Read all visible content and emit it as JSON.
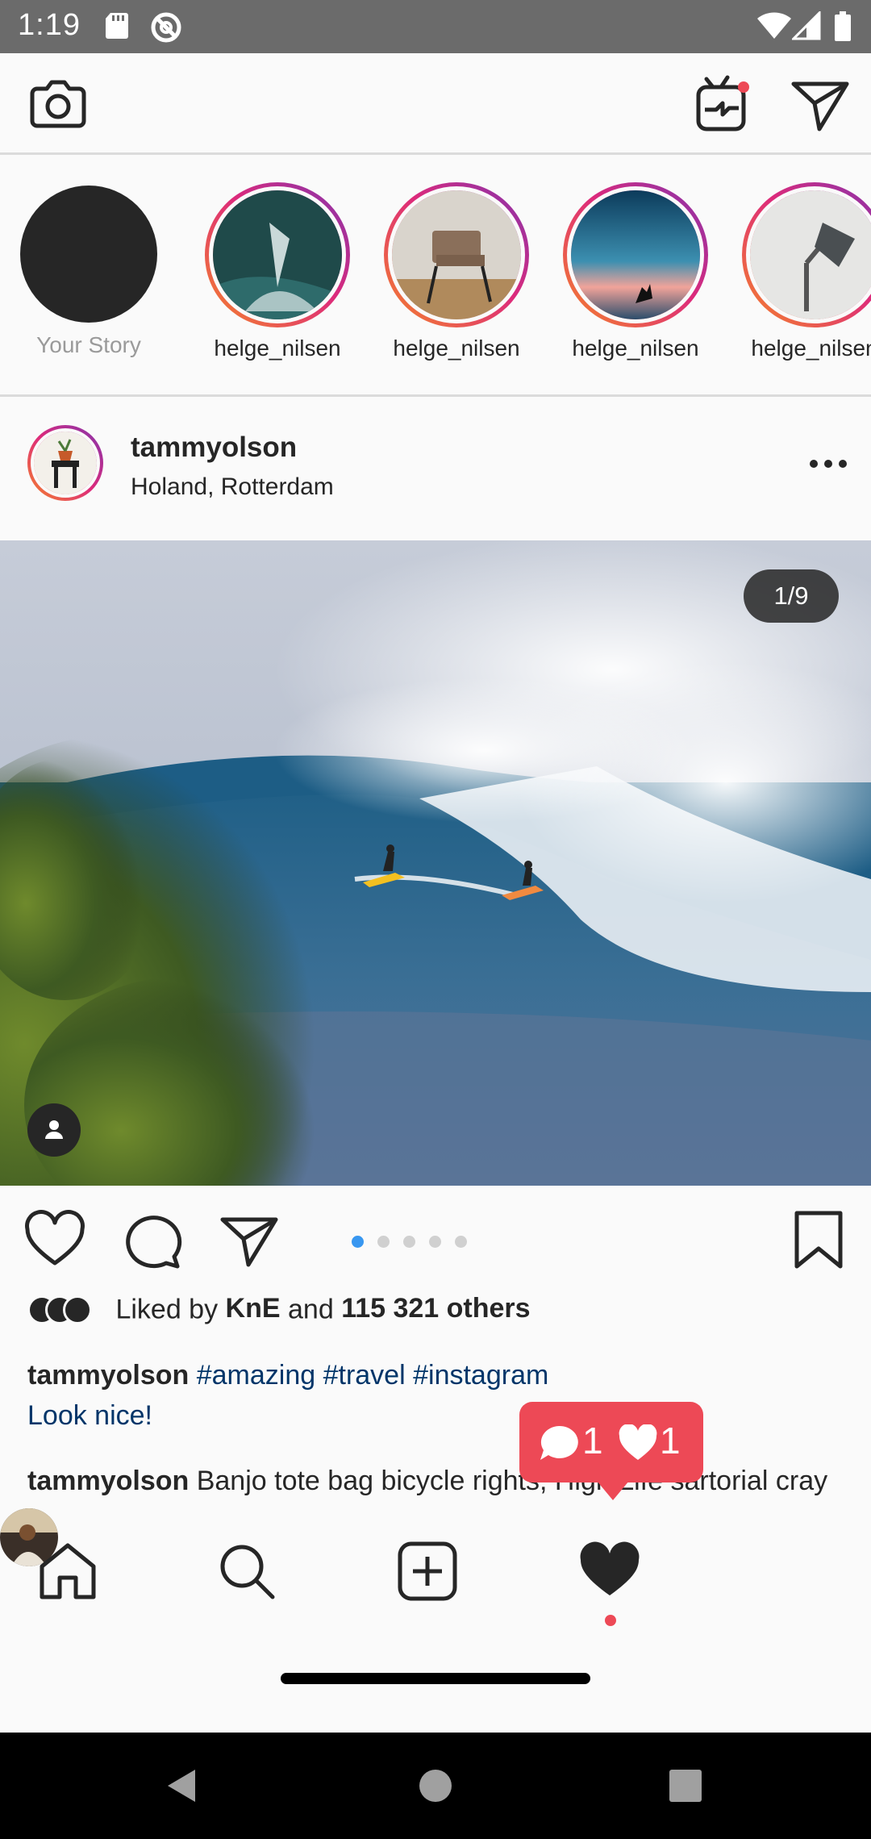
{
  "status_bar": {
    "time": "1:19",
    "icons": [
      "sd-card-icon",
      "no-sync-icon",
      "wifi-icon",
      "cellular-icon",
      "battery-icon"
    ]
  },
  "header": {
    "icons": [
      "camera-icon",
      "igtv-icon",
      "direct-message-icon"
    ],
    "igtv_notification": true
  },
  "stories": [
    {
      "label": "Your Story",
      "own": true
    },
    {
      "label": "helge_nilsen",
      "image": "ocean-surf"
    },
    {
      "label": "helge_nilsen",
      "image": "chair"
    },
    {
      "label": "helge_nilsen",
      "image": "sunset-sea"
    },
    {
      "label": "helge_nilsen",
      "image": "lamp"
    }
  ],
  "post": {
    "username": "tammyolson",
    "location": "Holand, Rotterdam",
    "image_counter": "1/9",
    "carousel": {
      "count": 5,
      "active": 0
    },
    "likes": {
      "prefix": "Liked by",
      "first_user": "KnE",
      "middle": "and",
      "others": "115 321 others"
    },
    "caption": {
      "username": "tammyolson",
      "tags": [
        "#amazing",
        "#travel",
        "#instagram"
      ],
      "line2": "Look nice!"
    },
    "comment": {
      "username": "tammyolson",
      "text": "Banjo tote bag bicycle rights, High Life sartorial cray craft beer whatever street art"
    }
  },
  "activity_toast": {
    "comments": "1",
    "likes": "1",
    "color": "#ed4956"
  },
  "bottom_nav": {
    "items": [
      "home-icon",
      "search-icon",
      "new-post-icon",
      "activity-heart-icon",
      "profile-avatar"
    ],
    "active": "activity-heart-icon"
  },
  "colors": {
    "accent": "#3897f0",
    "hashtag": "#003569",
    "notification": "#ed4956"
  }
}
